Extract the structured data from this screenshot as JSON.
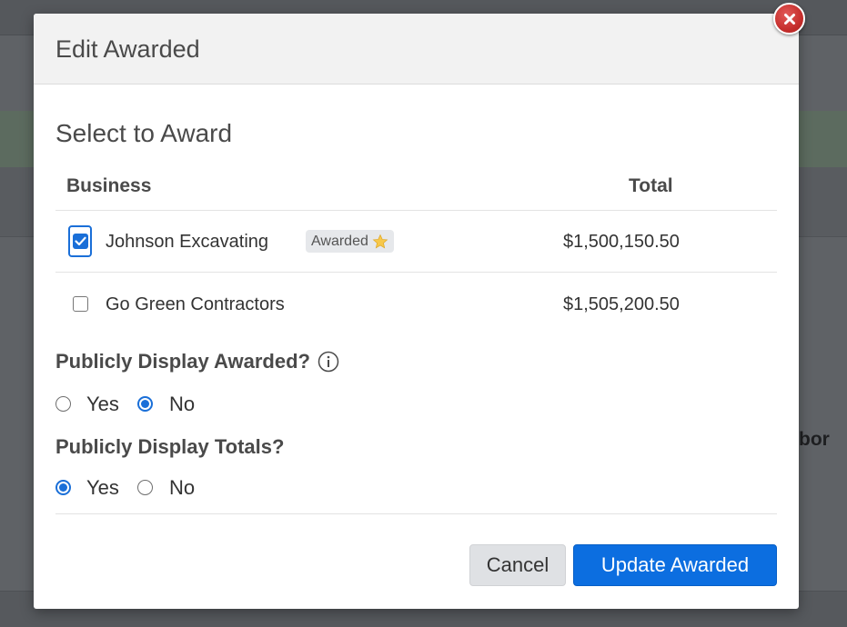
{
  "background": {
    "partial_text": "bor"
  },
  "modal": {
    "title": "Edit Awarded",
    "section_title": "Select to Award",
    "table": {
      "columns": [
        "Business",
        "Total"
      ],
      "rows": [
        {
          "business": "Johnson Excavating",
          "badge": "Awarded",
          "badge_icon": "star-icon",
          "total": "$1,500,150.50",
          "checked": true
        },
        {
          "business": "Go Green Contractors",
          "badge": "",
          "total": "$1,505,200.50",
          "checked": false
        }
      ]
    },
    "questions": [
      {
        "label": "Publicly Display Awarded?",
        "icon": "info-icon",
        "options": [
          "Yes",
          "No"
        ],
        "selected": "No"
      },
      {
        "label": "Publicly Display Totals?",
        "options": [
          "Yes",
          "No"
        ],
        "selected": "Yes"
      }
    ],
    "buttons": {
      "cancel": "Cancel",
      "update": "Update Awarded"
    }
  },
  "colors": {
    "primary": "#0c6ee0",
    "close": "#c62f2d",
    "badge_bg": "#e6e8eb"
  }
}
